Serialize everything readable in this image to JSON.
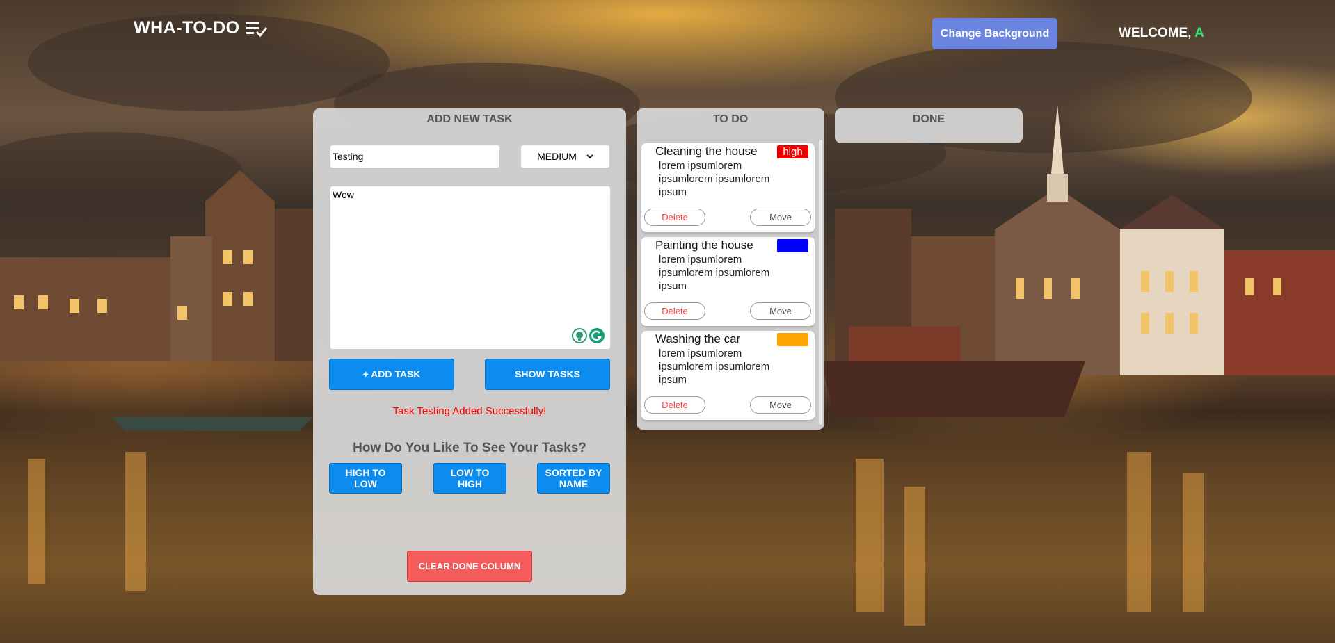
{
  "header": {
    "app_title": "WHA-TO-DO",
    "change_background_label": "Change Background",
    "welcome_label": "WELCOME,",
    "user_initial": "A"
  },
  "add_panel": {
    "title": "ADD NEW TASK",
    "task_name_value": "Testing",
    "priority_selected": "MEDIUM",
    "description_value": "Wow",
    "add_task_label": "+ ADD TASK",
    "show_tasks_label": "SHOW TASKS",
    "success_message": "Task Testing Added Successfully!",
    "sort_heading": "How Do You Like To See Your Tasks?",
    "sort_high_to_low": "HIGH TO LOW",
    "sort_low_to_high": "LOW TO HIGH",
    "sort_by_name": "SORTED BY NAME",
    "clear_done_label": "CLEAR DONE COLUMN"
  },
  "todo_panel": {
    "title": "TO DO",
    "tasks": [
      {
        "title": "Cleaning the house",
        "description": "lorem ipsumlorem ipsumlorem ipsumlorem ipsum",
        "priority_label": "high",
        "priority_color": "#ee0000",
        "delete_label": "Delete",
        "move_label": "Move"
      },
      {
        "title": "Painting the house",
        "description": "lorem ipsumlorem ipsumlorem ipsumlorem ipsum",
        "priority_label": "",
        "priority_color": "#0000ff",
        "delete_label": "Delete",
        "move_label": "Move"
      },
      {
        "title": "Washing the car",
        "description": "lorem ipsumlorem ipsumlorem ipsumlorem ipsum",
        "priority_label": "",
        "priority_color": "#ffa500",
        "delete_label": "Delete",
        "move_label": "Move"
      }
    ]
  },
  "done_panel": {
    "title": "DONE"
  },
  "colors": {
    "accent_blue": "#0d8cf0",
    "clear_red": "#f45b5b",
    "change_bg_button": "#6a84e0",
    "welcome_user": "#2ee86d",
    "message_red": "#ff0000"
  },
  "icons": {
    "title_icon": "checklist-icon",
    "select_arrow": "chevron-down-icon",
    "grammarly": "grammarly-icon"
  }
}
